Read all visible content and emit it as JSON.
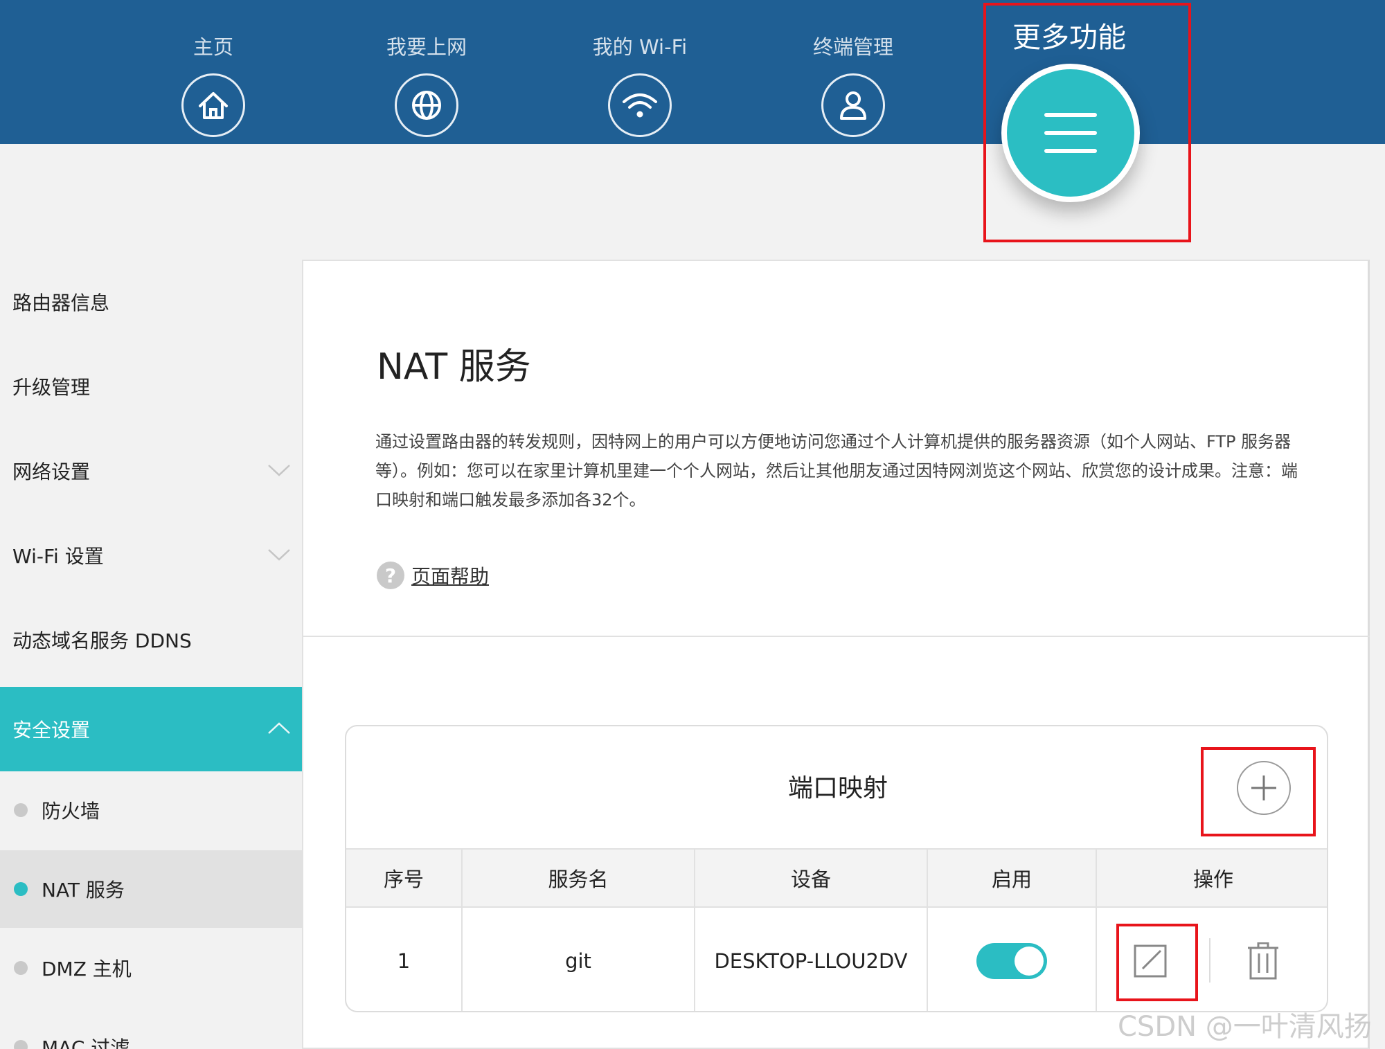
{
  "nav": {
    "items": [
      {
        "label": "主页",
        "icon": "home-icon"
      },
      {
        "label": "我要上网",
        "icon": "globe-icon"
      },
      {
        "label": "我的 Wi-Fi",
        "icon": "wifi-icon"
      },
      {
        "label": "终端管理",
        "icon": "user-icon"
      }
    ],
    "more_label": "更多功能",
    "more_icon": "menu-icon"
  },
  "sidebar": {
    "items": [
      "路由器信息",
      "升级管理",
      "网络设置",
      "Wi-Fi 设置",
      "动态域名服务 DDNS",
      "安全设置"
    ],
    "subitems": [
      "防火墙",
      "NAT 服务",
      "DMZ 主机",
      "MAC 过滤"
    ]
  },
  "main": {
    "title": "NAT 服务",
    "description": "通过设置路由器的转发规则，因特网上的用户可以方便地访问您通过个人计算机提供的服务器资源（如个人网站、FTP 服务器等）。例如：您可以在家里计算机里建一个个人网站，然后让其他朋友通过因特网浏览这个网站、欣赏您的设计成果。注意：端口映射和端口触发最多添加各32个。",
    "help_icon": "?",
    "help_label": "页面帮助",
    "port_mapping": {
      "title": "端口映射",
      "columns": [
        "序号",
        "服务名",
        "设备",
        "启用",
        "操作"
      ],
      "rows": [
        {
          "index": "1",
          "service": "git",
          "device": "DESKTOP-LLOU2DV",
          "enabled": true
        }
      ]
    }
  },
  "colors": {
    "topbar": "#1f5f94",
    "accent": "#2bbdc3",
    "highlight": "#e8141b"
  },
  "watermark": "CSDN @一叶清风扬"
}
